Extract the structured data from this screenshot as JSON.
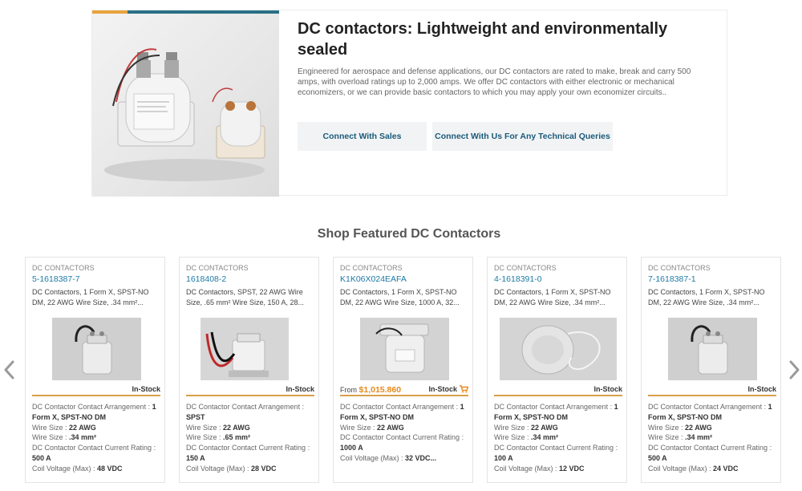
{
  "hero": {
    "title": "DC contactors: Lightweight and environmentally sealed",
    "description": "Engineered for aerospace and defense applications, our DC contactors are rated to make, break and carry 500 amps, with overload ratings up to 2,000 amps. We offer DC contactors with either electronic or mechanical economizers, or we can provide basic contactors to which you may apply your own economizer circuits..",
    "buttons": {
      "sales": "Connect With Sales",
      "technical": "Connect With Us For Any Technical Queries"
    }
  },
  "section_title": "Shop Featured DC Contactors",
  "colors": {
    "accent": "#d9a04a",
    "link": "#1e7aa6",
    "price": "#e8891a"
  },
  "icons": {
    "left": "chevron-left-icon",
    "right": "chevron-right-icon",
    "cart": "cart-icon"
  },
  "products": [
    {
      "category": "DC CONTACTORS",
      "part_number": "5-1618387-7",
      "description": "DC Contactors, 1 Form X, SPST-NO DM, 22 AWG Wire Size, .34 mm²...",
      "price_prefix": "",
      "price": "",
      "stock": "In-Stock",
      "specs": [
        {
          "label": "DC Contactor Contact Arrangement :",
          "value": "1 Form X, SPST-NO DM"
        },
        {
          "label": "Wire Size :",
          "value": "22 AWG"
        },
        {
          "label": "Wire Size :",
          "value": ".34 mm²"
        },
        {
          "label": "DC Contactor Contact Current Rating :",
          "value": "500 A"
        },
        {
          "label": "Coil Voltage (Max) :",
          "value": "48 VDC"
        }
      ]
    },
    {
      "category": "DC CONTACTORS",
      "part_number": "1618408-2",
      "description": "DC Contactors, SPST, 22 AWG Wire Size, .65 mm² Wire Size, 150 A, 28...",
      "price_prefix": "",
      "price": "",
      "stock": "In-Stock",
      "specs": [
        {
          "label": "DC Contactor Contact Arrangement :",
          "value": "SPST"
        },
        {
          "label": "Wire Size :",
          "value": "22 AWG"
        },
        {
          "label": "Wire Size :",
          "value": ".65 mm²"
        },
        {
          "label": "DC Contactor Contact Current Rating :",
          "value": "150 A"
        },
        {
          "label": "Coil Voltage (Max) :",
          "value": "28 VDC"
        }
      ]
    },
    {
      "category": "DC CONTACTORS",
      "part_number": "K1K06X024EAFA",
      "description": "DC Contactors, 1 Form X, SPST-NO DM, 22 AWG Wire Size, 1000 A, 32...",
      "price_prefix": "From",
      "price": "$1,015.860",
      "stock": "In-Stock",
      "specs": [
        {
          "label": "DC Contactor Contact Arrangement :",
          "value": "1 Form X, SPST-NO DM"
        },
        {
          "label": "Wire Size :",
          "value": "22 AWG"
        },
        {
          "label": "DC Contactor Contact Current Rating :",
          "value": "1000 A"
        },
        {
          "label": "Coil Voltage (Max) :",
          "value": "32 VDC..."
        }
      ]
    },
    {
      "category": "DC CONTACTORS",
      "part_number": "4-1618391-0",
      "description": "DC Contactors, 1 Form X, SPST-NO DM, 22 AWG Wire Size, .34 mm²...",
      "price_prefix": "",
      "price": "",
      "stock": "In-Stock",
      "specs": [
        {
          "label": "DC Contactor Contact Arrangement :",
          "value": "1 Form X, SPST-NO DM"
        },
        {
          "label": "Wire Size :",
          "value": "22 AWG"
        },
        {
          "label": "Wire Size :",
          "value": ".34 mm²"
        },
        {
          "label": "DC Contactor Contact Current Rating :",
          "value": "100 A"
        },
        {
          "label": "Coil Voltage (Max) :",
          "value": "12 VDC"
        }
      ]
    },
    {
      "category": "DC CONTACTORS",
      "part_number": "7-1618387-1",
      "description": "DC Contactors, 1 Form X, SPST-NO DM, 22 AWG Wire Size, .34 mm²...",
      "price_prefix": "",
      "price": "",
      "stock": "In-Stock",
      "specs": [
        {
          "label": "DC Contactor Contact Arrangement :",
          "value": "1 Form X, SPST-NO DM"
        },
        {
          "label": "Wire Size :",
          "value": "22 AWG"
        },
        {
          "label": "Wire Size :",
          "value": ".34 mm²"
        },
        {
          "label": "DC Contactor Contact Current Rating :",
          "value": "500 A"
        },
        {
          "label": "Coil Voltage (Max) :",
          "value": "24 VDC"
        }
      ]
    }
  ]
}
